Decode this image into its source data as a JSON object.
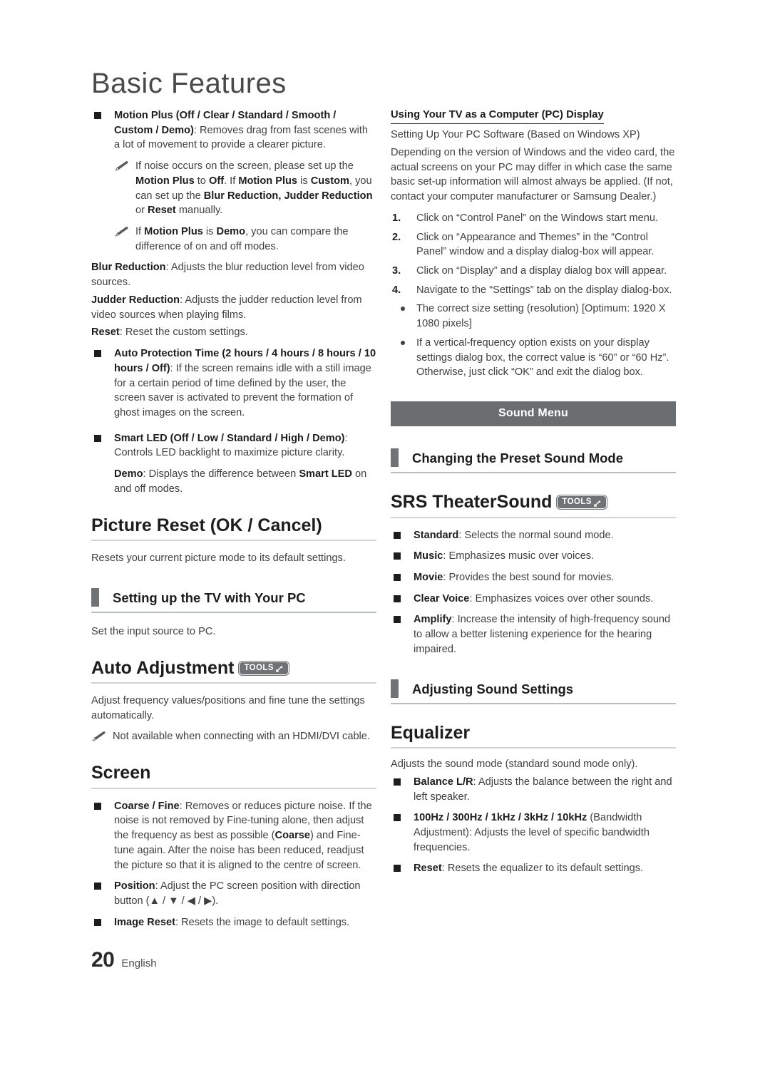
{
  "page": {
    "title": "Basic Features",
    "footer_number": "20",
    "footer_language": "English"
  },
  "colors": {
    "banner_bg": "#6a6e70",
    "section_bar": "#6f7375",
    "rule": "#cfd3d4",
    "text": "#404040",
    "bold_text": "#1d1d1d"
  },
  "left_column": {
    "motion_plus": {
      "bullet_bold": "Motion Plus (Off / Clear / Standard / Smooth / Custom / Demo)",
      "bullet_rest": ": Removes drag from fast scenes with a lot of movement to provide a clearer picture."
    },
    "notes": [
      {
        "id": "note-motion-plus-noise",
        "parts": [
          {
            "t": "If noise occurs on the screen, please set up the ",
            "b": false
          },
          {
            "t": "Motion Plus",
            "b": true
          },
          {
            "t": " to ",
            "b": false
          },
          {
            "t": "Off",
            "b": true
          },
          {
            "t": ". If ",
            "b": false
          },
          {
            "t": "Motion Plus",
            "b": true
          },
          {
            "t": " is ",
            "b": false
          },
          {
            "t": "Custom",
            "b": true
          },
          {
            "t": ", you can set up the ",
            "b": false
          },
          {
            "t": "Blur Reduction, Judder Reduction",
            "b": true
          },
          {
            "t": " or ",
            "b": false
          },
          {
            "t": "Reset",
            "b": true
          },
          {
            "t": " manually.",
            "b": false
          }
        ]
      },
      {
        "id": "note-motion-plus-demo",
        "parts": [
          {
            "t": "If ",
            "b": false
          },
          {
            "t": "Motion Plus",
            "b": true
          },
          {
            "t": " is ",
            "b": false
          },
          {
            "t": "Demo",
            "b": true
          },
          {
            "t": ", you can compare the difference of on and off modes.",
            "b": false
          }
        ]
      }
    ],
    "blur_reduction": {
      "label": "Blur Reduction",
      "text": ": Adjusts the blur reduction level from video sources."
    },
    "judder_reduction": {
      "label": "Judder Reduction",
      "text": ": Adjusts the judder reduction level from video sources when playing films."
    },
    "reset_custom": {
      "label": "Reset",
      "text": ": Reset the custom settings."
    },
    "auto_protection": {
      "bullet_bold": "Auto Protection Time (2 hours / 4 hours / 8 hours / 10 hours / Off)",
      "bullet_rest": ": If the screen remains idle with a still image for a certain period of time defined by the user, the screen saver is activated to prevent the formation of ghost images on the screen."
    },
    "smart_led": {
      "bullet_bold": "Smart LED (Off / Low / Standard / High / Demo)",
      "bullet_rest": ": Controls LED backlight to maximize picture clarity."
    },
    "smart_led_demo": {
      "label": "Demo",
      "text_1": ": Displays the difference between ",
      "emphasis": "Smart LED",
      "text_2": " on and off modes."
    },
    "picture_reset": {
      "heading": "Picture Reset (OK / Cancel)",
      "body": "Resets your current picture mode to its default settings."
    },
    "setting_up_tv_pc": {
      "heading": "Setting up the TV with Your PC",
      "body": "Set the input source to PC."
    },
    "auto_adjustment": {
      "heading": "Auto Adjustment",
      "badge": "TOOLS",
      "body": "Adjust frequency values/positions and fine tune the settings automatically.",
      "note": "Not available when connecting with an HDMI/DVI cable."
    },
    "screen": {
      "heading": "Screen",
      "items": [
        {
          "id": "coarse-fine",
          "parts": [
            {
              "t": "Coarse / Fine",
              "b": true
            },
            {
              "t": ": Removes or reduces picture noise. If the noise is not removed by Fine-tuning alone, then adjust the frequency as best as possible (",
              "b": false
            },
            {
              "t": "Coarse",
              "b": true
            },
            {
              "t": ") and Fine-tune again. After the noise has been reduced, readjust the picture so that it is aligned to the centre of screen.",
              "b": false
            }
          ]
        },
        {
          "id": "position",
          "parts": [
            {
              "t": "Position",
              "b": true
            },
            {
              "t": ": Adjust the PC screen position with direction button (▲ / ▼ / ◀ / ▶).",
              "b": false
            }
          ]
        },
        {
          "id": "image-reset",
          "parts": [
            {
              "t": "Image Reset",
              "b": true
            },
            {
              "t": ": Resets the image to default settings.",
              "b": false
            }
          ]
        }
      ]
    }
  },
  "right_column": {
    "pc_display": {
      "subtitle": "Using Your TV as a Computer (PC) Display",
      "line_1": "Setting Up Your PC Software (Based on Windows XP)",
      "line_2": "Depending on the version of Windows and the video card, the actual screens on your PC may differ in which case the same basic set-up information will almost always be applied. (If not, contact your computer manufacturer or Samsung Dealer.)",
      "steps": [
        {
          "num": "1.",
          "text": "Click on “Control Panel” on the Windows start menu."
        },
        {
          "num": "2.",
          "text": "Click on “Appearance and Themes” in the “Control Panel” window and a display dialog-box will appear."
        },
        {
          "num": "3.",
          "text": "Click on “Display” and a display dialog box will appear."
        },
        {
          "num": "4.",
          "text": "Navigate to the “Settings” tab on the display dialog-box."
        }
      ],
      "dots": [
        "The correct size setting (resolution) [Optimum: 1920 X 1080 pixels]",
        "If a vertical-frequency option exists on your display settings dialog box, the correct value is “60” or “60 Hz”. Otherwise, just click “OK” and exit the dialog box."
      ]
    },
    "sound_menu_banner": "Sound Menu",
    "changing_preset": {
      "heading": "Changing the Preset Sound Mode"
    },
    "srs": {
      "heading": "SRS TheaterSound",
      "badge": "TOOLS",
      "items": [
        {
          "id": "standard",
          "label": "Standard",
          "text": ": Selects the normal sound mode."
        },
        {
          "id": "music",
          "label": "Music",
          "text": ": Emphasizes music over voices."
        },
        {
          "id": "movie",
          "label": "Movie",
          "text": ": Provides the best sound for movies."
        },
        {
          "id": "clear-voice",
          "label": "Clear Voice",
          "text": ": Emphasizes voices over other sounds."
        },
        {
          "id": "amplify",
          "label": "Amplify",
          "text": ": Increase the intensity of high-frequency sound to allow a better listening experience for the hearing impaired."
        }
      ]
    },
    "adjusting_sound": {
      "heading": "Adjusting Sound Settings"
    },
    "equalizer": {
      "heading": "Equalizer",
      "body": "Adjusts the sound mode (standard sound mode only).",
      "items": [
        {
          "id": "balance-lr",
          "label": "Balance L/R",
          "text": ": Adjusts the balance between the right and left speaker."
        },
        {
          "id": "bandwidth",
          "label": "100Hz / 300Hz / 1kHz / 3kHz / 10kHz",
          "text": " (Bandwidth Adjustment): Adjusts the level of specific bandwidth frequencies."
        },
        {
          "id": "eq-reset",
          "label": "Reset",
          "text": ": Resets the equalizer to its default settings."
        }
      ]
    }
  }
}
